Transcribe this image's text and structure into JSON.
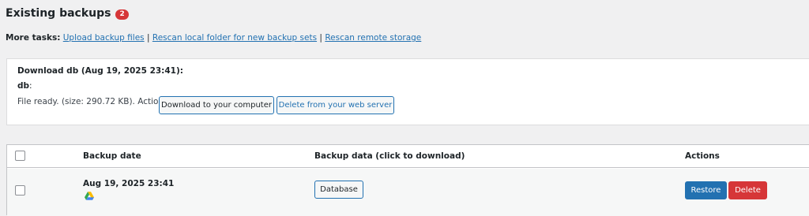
{
  "heading": {
    "title": "Existing backups",
    "count": "2"
  },
  "more_tasks": {
    "label": "More tasks:",
    "links": [
      "Upload backup files",
      "Rescan local folder for new backup sets",
      "Rescan remote storage"
    ],
    "separator": "|"
  },
  "download_box": {
    "title": "Download db (Aug 19, 2025 23:41):",
    "entity": "db",
    "entity_suffix": ":",
    "status": "File ready. (size: 290.72 KB). Actions:",
    "download_button": "Download to your computer",
    "delete_button": "Delete from your web server"
  },
  "table": {
    "columns": [
      "Backup date",
      "Backup data (click to download)",
      "Actions"
    ],
    "rows": [
      {
        "date": "Aug 19, 2025 23:41",
        "storage_icon": "google-drive-icon",
        "data_button": "Database",
        "restore_label": "Restore",
        "delete_label": "Delete"
      }
    ]
  },
  "colors": {
    "accent": "#2271b1",
    "danger": "#d63638",
    "background": "#f0f0f1"
  }
}
